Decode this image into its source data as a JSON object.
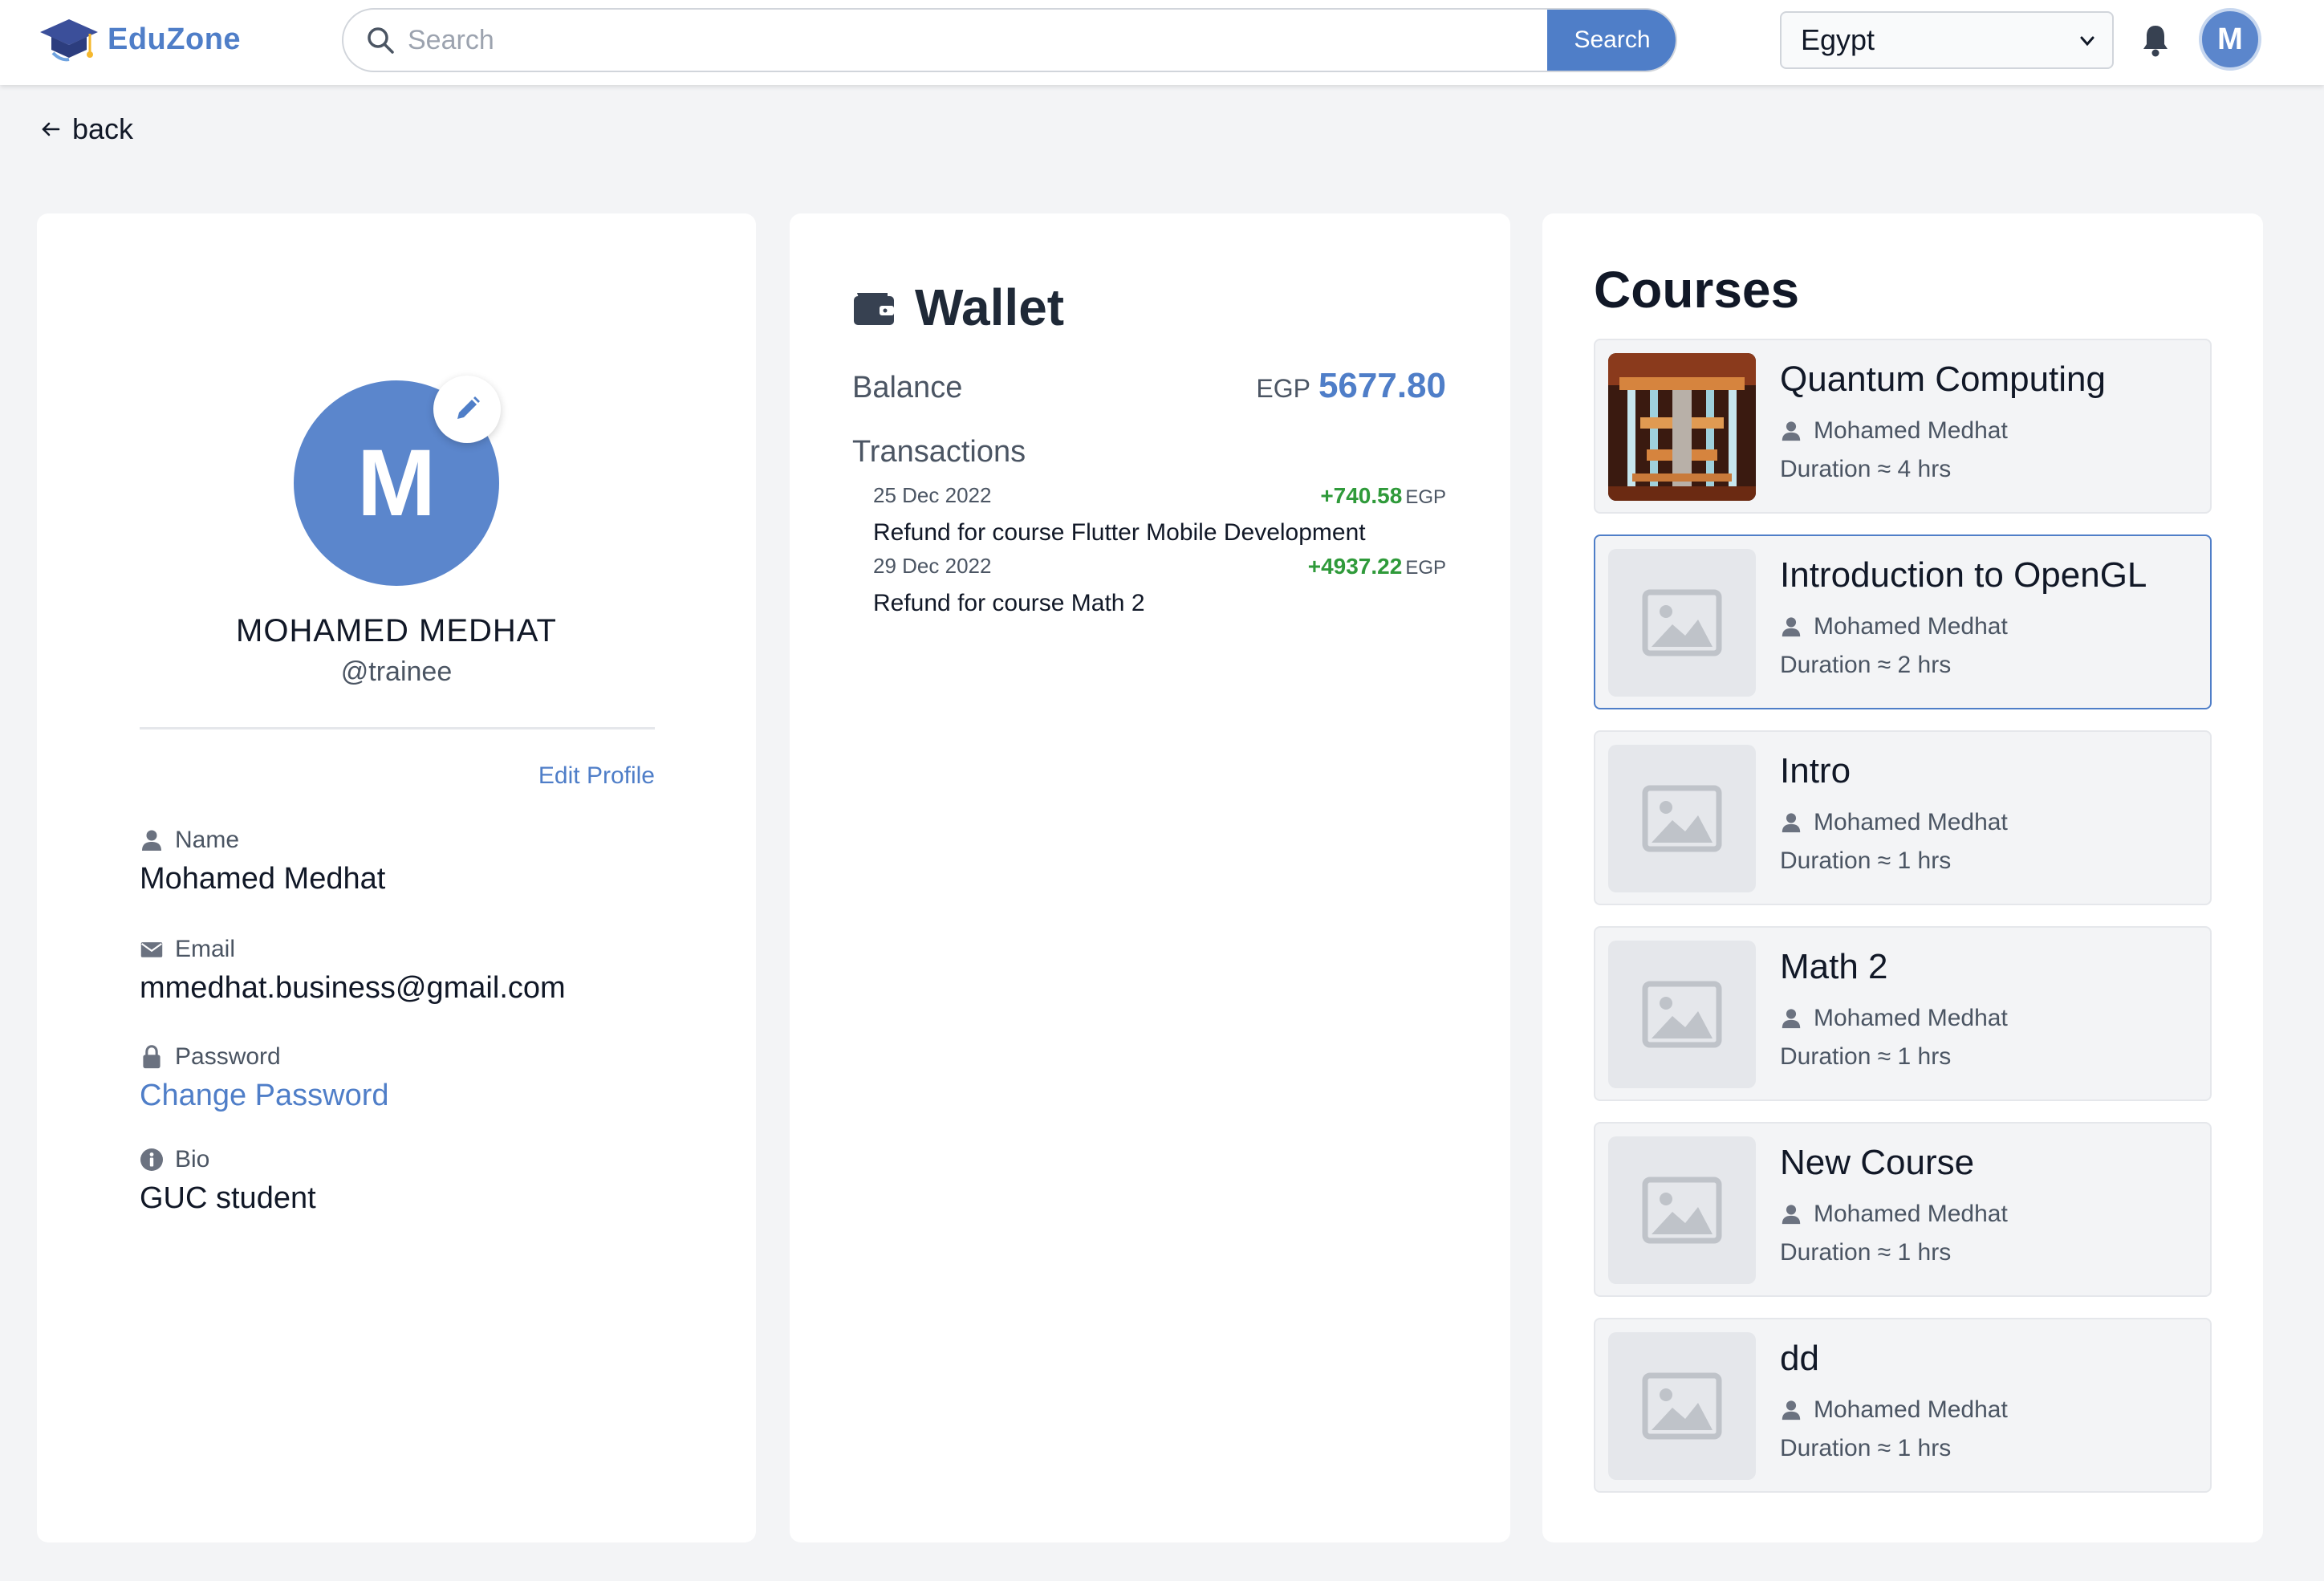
{
  "app": {
    "name": "EduZone"
  },
  "search": {
    "placeholder": "Search",
    "button_label": "Search"
  },
  "country": {
    "selected": "Egypt"
  },
  "user_avatar_initial": "M",
  "back_label": "back",
  "profile": {
    "avatar_initial": "M",
    "name_upper": "MOHAMED MEDHAT",
    "handle": "@trainee",
    "edit_profile_label": "Edit Profile",
    "fields": {
      "name": {
        "label": "Name",
        "value": "Mohamed Medhat"
      },
      "email": {
        "label": "Email",
        "value": "mmedhat.business@gmail.com"
      },
      "password": {
        "label": "Password",
        "value": "Change Password"
      },
      "bio": {
        "label": "Bio",
        "value": "GUC student"
      }
    }
  },
  "wallet": {
    "title": "Wallet",
    "balance_label": "Balance",
    "balance_currency": "EGP",
    "balance_amount": "5677.80",
    "transactions_label": "Transactions",
    "transactions": [
      {
        "date": "25 Dec 2022",
        "amount": "+740.58",
        "currency": "EGP",
        "description": "Refund for course Flutter Mobile Development"
      },
      {
        "date": "29 Dec 2022",
        "amount": "+4937.22",
        "currency": "EGP",
        "description": "Refund for course Math 2"
      }
    ]
  },
  "courses": {
    "title": "Courses",
    "items": [
      {
        "name": "Quantum Computing",
        "author": "Mohamed Medhat",
        "duration": "Duration ≈ 4 hrs",
        "thumbnail": "quantum-computer-image"
      },
      {
        "name": "Introduction to OpenGL",
        "author": "Mohamed Medhat",
        "duration": "Duration ≈ 2 hrs",
        "thumbnail": "image-placeholder-icon"
      },
      {
        "name": "Intro",
        "author": "Mohamed Medhat",
        "duration": "Duration ≈ 1 hrs",
        "thumbnail": "image-placeholder-icon"
      },
      {
        "name": "Math 2",
        "author": "Mohamed Medhat",
        "duration": "Duration ≈ 1 hrs",
        "thumbnail": "image-placeholder-icon"
      },
      {
        "name": "New Course",
        "author": "Mohamed Medhat",
        "duration": "Duration ≈ 1 hrs",
        "thumbnail": "image-placeholder-icon"
      },
      {
        "name": "dd",
        "author": "Mohamed Medhat",
        "duration": "Duration ≈ 1 hrs",
        "thumbnail": "image-placeholder-icon"
      }
    ]
  },
  "colors": {
    "brand": "#4f7ec8",
    "positive": "#2f9a3a",
    "background": "#f3f4f6"
  }
}
